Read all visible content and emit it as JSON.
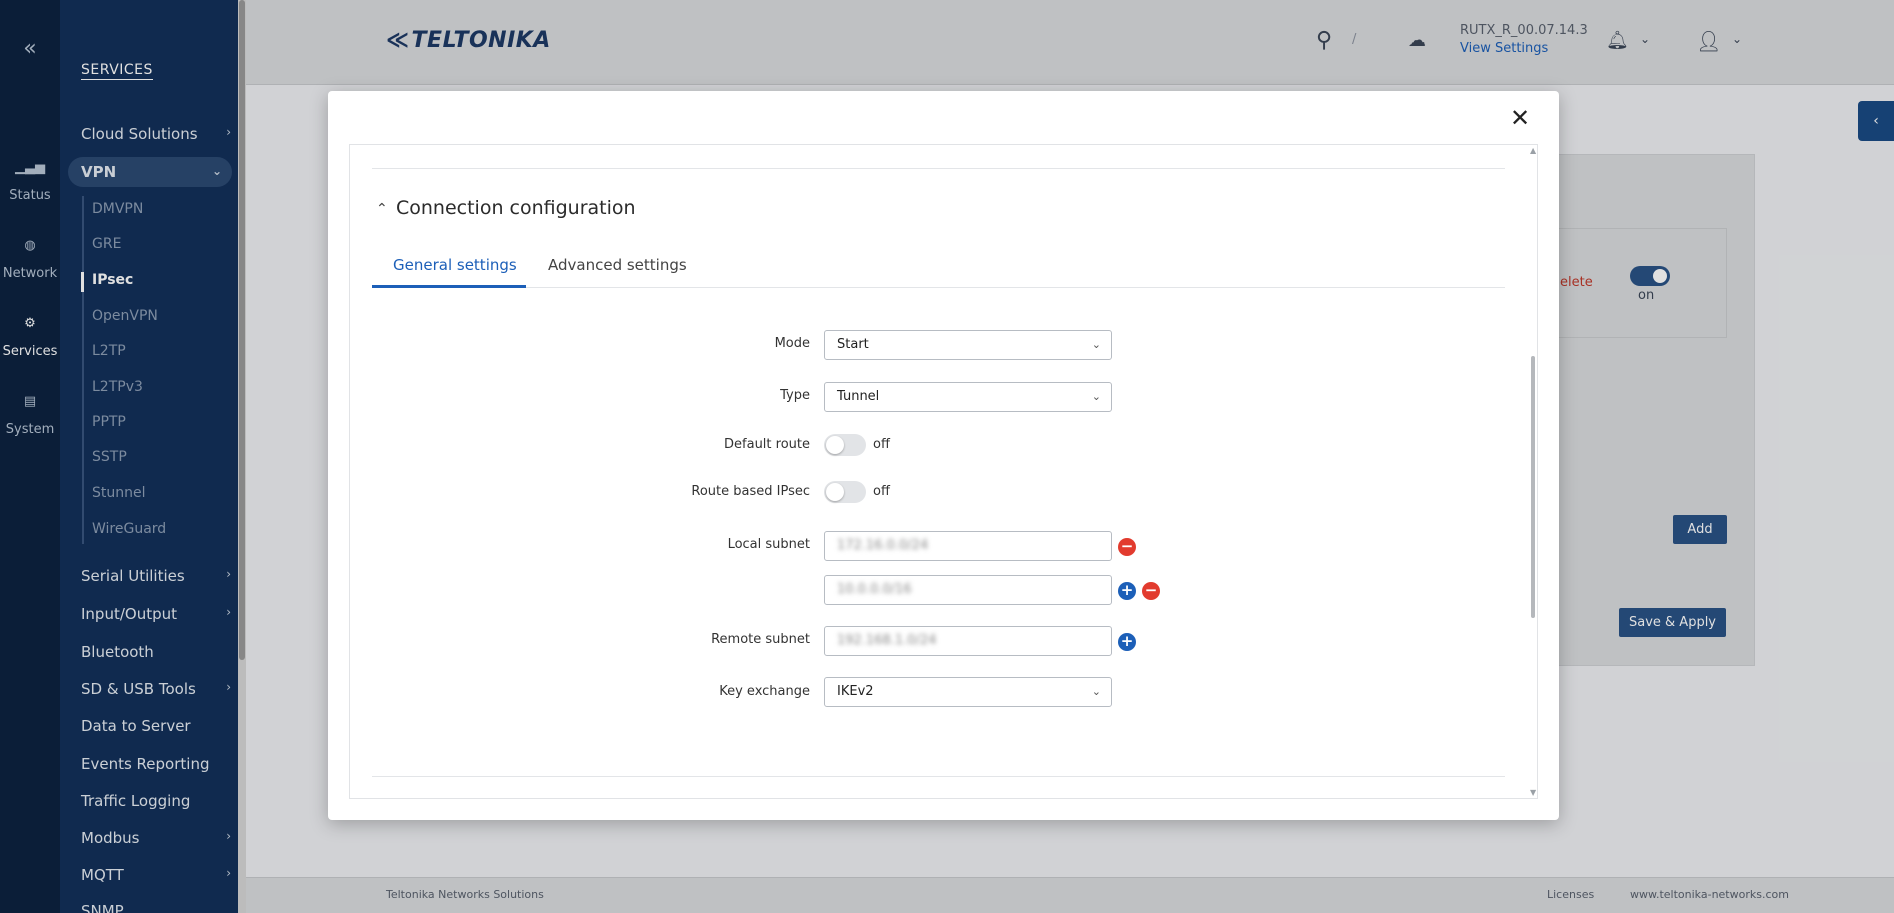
{
  "rail": {
    "items": [
      {
        "label": "Status",
        "icon": "bar-chart-icon"
      },
      {
        "label": "Network",
        "icon": "globe-icon"
      },
      {
        "label": "Services",
        "icon": "gear-icon"
      },
      {
        "label": "System",
        "icon": "file-icon"
      }
    ]
  },
  "menu": {
    "title": "SERVICES",
    "items": [
      {
        "label": "Cloud Solutions"
      },
      {
        "label": "VPN"
      },
      {
        "label": "Serial Utilities"
      },
      {
        "label": "Input/Output"
      },
      {
        "label": "Bluetooth"
      },
      {
        "label": "SD & USB Tools"
      },
      {
        "label": "Data to Server"
      },
      {
        "label": "Events Reporting"
      },
      {
        "label": "Traffic Logging"
      },
      {
        "label": "Modbus"
      },
      {
        "label": "MQTT"
      },
      {
        "label": "SNMP"
      }
    ],
    "vpn_sub": [
      "DMVPN",
      "GRE",
      "IPsec",
      "OpenVPN",
      "L2TP",
      "L2TPv3",
      "PPTP",
      "SSTP",
      "Stunnel",
      "WireGuard"
    ]
  },
  "header": {
    "logo": "TELTONIKA",
    "search_shortcut": "/",
    "firmware": "RUTX_R_00.07.14.3",
    "view_settings": "View Settings"
  },
  "background": {
    "delete_label": "elete",
    "toggle_label": "on",
    "add_label": "Add",
    "save_apply_label": "Save & Apply"
  },
  "footer": {
    "company": "Teltonika Networks Solutions",
    "licenses": "Licenses",
    "website": "www.teltonika-networks.com"
  },
  "modal": {
    "section_title": "Connection configuration",
    "tabs": [
      {
        "label": "General settings",
        "active": true
      },
      {
        "label": "Advanced settings",
        "active": false
      }
    ],
    "fields": {
      "mode": {
        "label": "Mode",
        "value": "Start"
      },
      "type": {
        "label": "Type",
        "value": "Tunnel"
      },
      "default_route": {
        "label": "Default route",
        "state": "off"
      },
      "route_based": {
        "label": "Route based IPsec",
        "state": "off"
      },
      "local_subnet": {
        "label": "Local subnet",
        "values": [
          "172.16.0.0/24",
          "10.0.0.0/16"
        ]
      },
      "remote_subnet": {
        "label": "Remote subnet",
        "value": "192.168.1.0/24"
      },
      "key_exchange": {
        "label": "Key exchange",
        "value": "IKEv2"
      }
    }
  },
  "colors": {
    "accent": "#1c5fb8",
    "nav_dark": "#0d2340",
    "nav_panel": "#13305a",
    "danger": "#e23b2e"
  }
}
